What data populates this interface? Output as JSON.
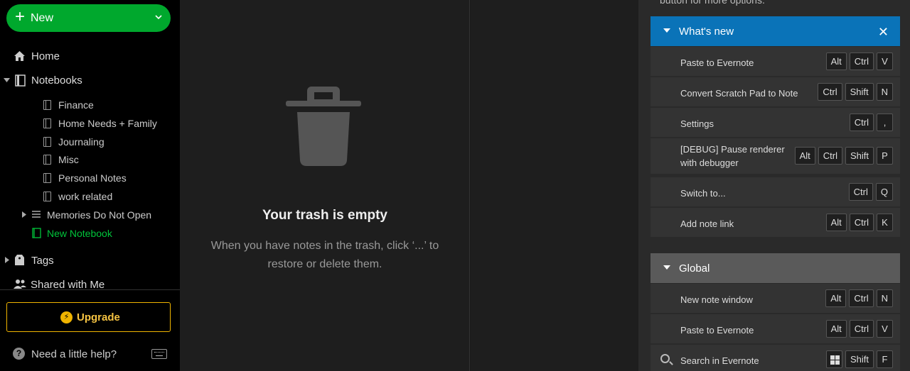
{
  "sidebar": {
    "new_label": "New",
    "home_label": "Home",
    "notebooks_label": "Notebooks",
    "notebooks": [
      "Finance",
      "Home Needs + Family",
      "Journaling",
      "Misc",
      "Personal Notes",
      "work related"
    ],
    "stack_label": "Memories Do Not Open",
    "new_notebook_label": "New Notebook",
    "tags_label": "Tags",
    "shared_label": "Shared with Me",
    "upgrade_label": "Upgrade",
    "help_label": "Need a little help?"
  },
  "main": {
    "trash_title": "Your trash is empty",
    "trash_desc": "When you have notes in the trash, click ‘...’ to restore or delete them."
  },
  "panel": {
    "top_text": "button for more options.",
    "whats_new_title": "What's new",
    "whats_new": [
      {
        "label": "Paste to Evernote",
        "keys": [
          "Alt",
          "Ctrl",
          "V"
        ]
      },
      {
        "label": "Convert Scratch Pad to Note",
        "keys": [
          "Ctrl",
          "Shift",
          "N"
        ]
      },
      {
        "label": "Settings",
        "keys": [
          "Ctrl",
          ","
        ]
      },
      {
        "label": "[DEBUG] Pause renderer with debugger",
        "keys": [
          "Alt",
          "Ctrl",
          "Shift",
          "P"
        ]
      },
      {
        "label": "Switch to...",
        "keys": [
          "Ctrl",
          "Q"
        ]
      },
      {
        "label": "Add note link",
        "keys": [
          "Alt",
          "Ctrl",
          "K"
        ]
      }
    ],
    "global_title": "Global",
    "global": [
      {
        "label": "New note window",
        "keys": [
          "Alt",
          "Ctrl",
          "N"
        ]
      },
      {
        "label": "Paste to Evernote",
        "keys": [
          "Alt",
          "Ctrl",
          "V"
        ]
      },
      {
        "label": "Search in Evernote",
        "keys": [
          "Shift",
          "F"
        ]
      }
    ]
  },
  "colors": {
    "accent": "#00a82d",
    "upgrade": "#f0b400",
    "section_blue": "#0a73b8",
    "section_gray": "#5a5a5a"
  }
}
